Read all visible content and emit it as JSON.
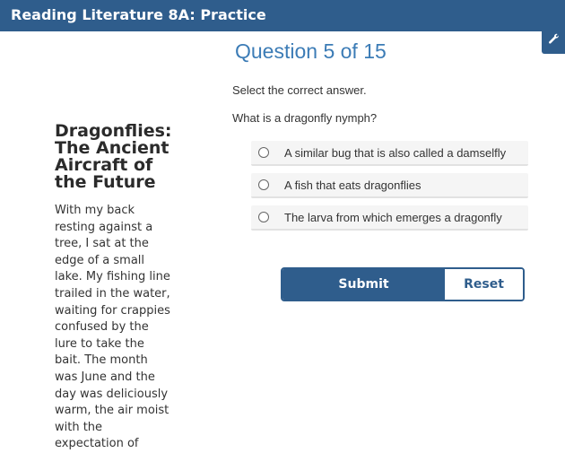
{
  "header": {
    "title": "Reading Literature 8A: Practice",
    "tool_icon": "wrench-icon"
  },
  "question": {
    "heading": "Question 5 of 15",
    "instruction": "Select the correct answer.",
    "prompt": "What is a dragonfly nymph?",
    "options": [
      {
        "label": "A similar bug that is also called a damselfly",
        "selected": false
      },
      {
        "label": "A fish that eats dragonflies",
        "selected": false
      },
      {
        "label": "The larva from which emerges a dragonfly",
        "selected": false
      }
    ],
    "submit_label": "Submit",
    "reset_label": "Reset"
  },
  "passage": {
    "title_lines": [
      "Dragonflies:",
      "The Ancient",
      "Aircraft of",
      "the Future"
    ],
    "body_lines": [
      "With my back",
      "resting against a",
      "tree, I sat at the",
      "edge of a small",
      "lake. My fishing line",
      "trailed in the water,",
      "waiting for crappies",
      "confused by the",
      "lure to take the",
      "bait. The month",
      "was June and the",
      "day was deliciously",
      "warm, the air moist",
      "with the",
      "expectation of"
    ]
  },
  "colors": {
    "brand": "#2f5d8c",
    "heading": "#3c7cb6",
    "option_bg": "#f5f5f5"
  }
}
